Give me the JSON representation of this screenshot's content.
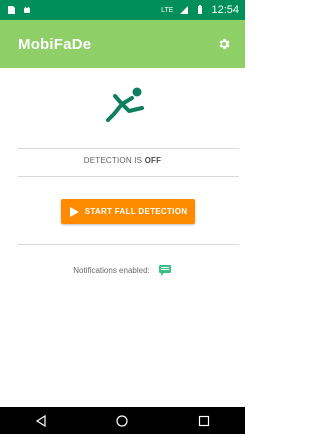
{
  "status_bar": {
    "time": "12:54",
    "network_label": "LTE",
    "icons": [
      "sd-card-icon",
      "android-icon",
      "signal-icon",
      "battery-icon"
    ]
  },
  "app_bar": {
    "title": "MobiFaDe",
    "settings_icon": "gear-icon"
  },
  "main": {
    "hero_icon": "falling-person-icon",
    "detection_prefix": "DETECTION IS ",
    "detection_state": "OFF",
    "start_button_label": "START FALL DETECTION",
    "notifications_label": "Notifications enabled:",
    "notifications_icon": "message-icon"
  },
  "nav_bar": {
    "buttons": [
      "back-icon",
      "home-icon",
      "recents-icon"
    ]
  },
  "colors": {
    "status_bar": "#008f5b",
    "app_bar": "#8fcf67",
    "accent": "#ff8c00",
    "icon_green": "#0f7f5f",
    "notif_icon": "#3fbf86"
  }
}
